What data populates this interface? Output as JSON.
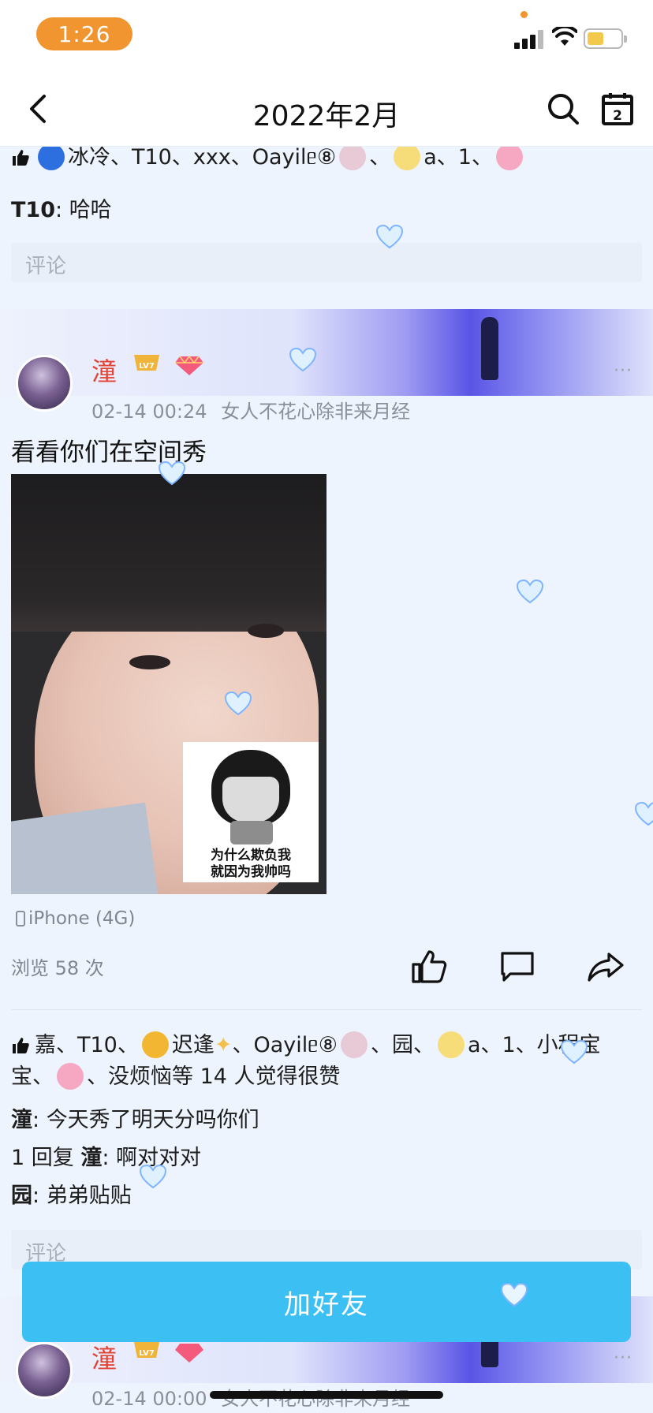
{
  "status_bar": {
    "time": "1:26"
  },
  "nav": {
    "title": "2022年2月"
  },
  "prev_post": {
    "likes_text": "冰冷、T10、xxx、Oayilᥱ⑧",
    "likes_tail": "a、1、",
    "comment_author": "T10",
    "comment_text": "哈哈",
    "comment_placeholder": "评论"
  },
  "post": {
    "author": "潼",
    "timestamp": "02-14 00:24",
    "signature": "女人不花心除非来月经",
    "more": "···",
    "text": "看看你们在空间秀",
    "meme_caption_line1": "为什么欺负我",
    "meme_caption_line2": "就因为我帅吗",
    "device": "iPhone (4G)",
    "views": "浏览 58 次",
    "likes_a": "嘉、T10、",
    "likes_b": "迟逢",
    "likes_c": "、Oayilᥱ⑧",
    "likes_d": "、园、",
    "likes_e": "a、1、小程宝宝、",
    "likes_f": "、没烦恼等 14 人觉得很赞",
    "comments": [
      {
        "author": "潼",
        "text": "今天秀了明天分吗你们"
      },
      {
        "prefix": "1 回复",
        "author": "潼",
        "text": "啊对对对"
      },
      {
        "author": "园",
        "text": "弟弟贴贴"
      }
    ],
    "comment_placeholder": "评论"
  },
  "next_post": {
    "author": "潼",
    "timestamp": "02-14 00:00",
    "signature": "女人不花心除非来月经",
    "more": "···"
  },
  "cta": {
    "label": "加好友"
  },
  "colors": {
    "accent": "#3cc0f4",
    "time_pill": "#f0952f",
    "author_name": "#e14436"
  }
}
